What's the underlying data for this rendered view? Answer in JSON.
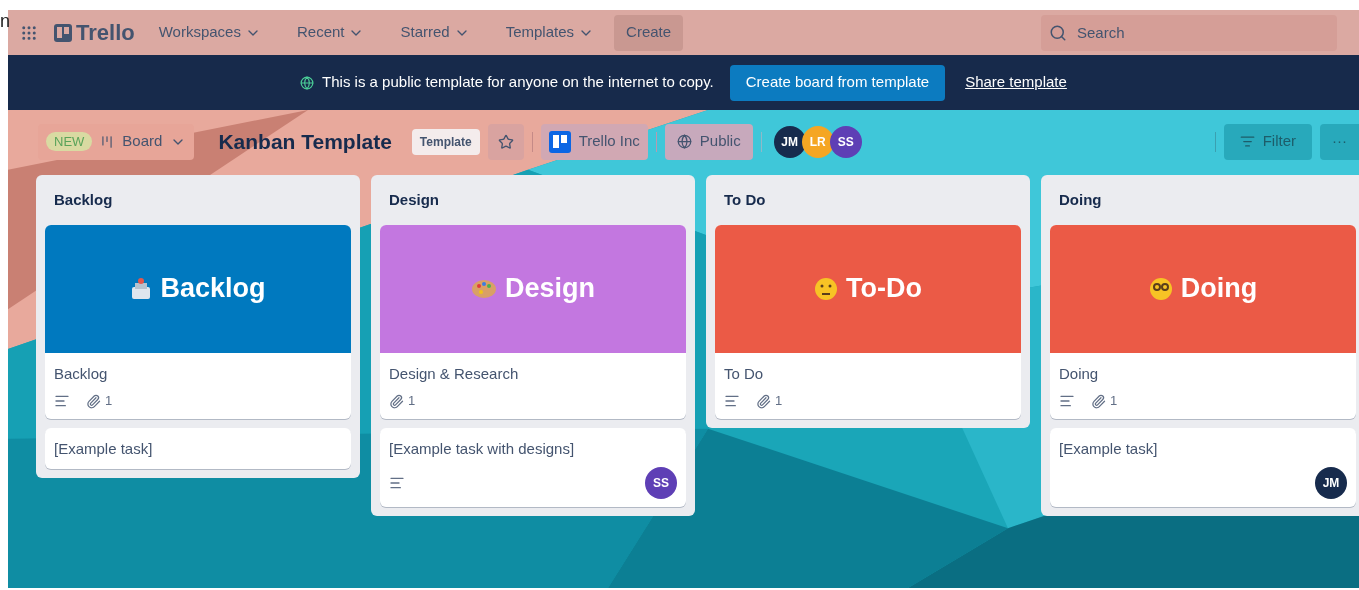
{
  "edge_fragment": "n",
  "nav": {
    "logo": "Trello",
    "menus": [
      {
        "label": "Workspaces"
      },
      {
        "label": "Recent"
      },
      {
        "label": "Starred"
      },
      {
        "label": "Templates"
      }
    ],
    "create": "Create",
    "search": {
      "placeholder": "Search"
    }
  },
  "banner": {
    "text": "This is a public template for anyone on the internet to copy.",
    "button": "Create board from template",
    "link": "Share template"
  },
  "board_header": {
    "new_badge": "NEW",
    "view": "Board",
    "title": "Kanban Template",
    "template_badge": "Template",
    "starred": false,
    "workspace": "Trello Inc",
    "visibility": "Public",
    "members": [
      {
        "initials": "JM",
        "color": "#172b4d"
      },
      {
        "initials": "LR",
        "color": "#f5a623"
      },
      {
        "initials": "SS",
        "color": "#5e3fb5"
      }
    ],
    "filter": "Filter",
    "more": "···"
  },
  "lists": [
    {
      "title": "Backlog",
      "cards": [
        {
          "cover": {
            "title": "Backlog",
            "color": "#0079bf"
          },
          "title": "Backlog",
          "description": true,
          "attachments": "1"
        },
        {
          "title": "[Example task]",
          "description": false
        }
      ]
    },
    {
      "title": "Design",
      "cards": [
        {
          "cover": {
            "title": "Design",
            "color": "#c377e0"
          },
          "title": "Design & Research",
          "description": false,
          "attachments": "1"
        },
        {
          "title": "[Example task with designs]",
          "description": true,
          "member": {
            "initials": "SS",
            "color": "#5e3fb5"
          }
        }
      ]
    },
    {
      "title": "To Do",
      "cards": [
        {
          "cover": {
            "title": "To-Do",
            "color": "#eb5a46"
          },
          "title": "To Do",
          "description": true,
          "attachments": "1"
        }
      ]
    },
    {
      "title": "Doing",
      "cards": [
        {
          "cover": {
            "title": "Doing",
            "color": "#eb5a46"
          },
          "title": "Doing",
          "description": true,
          "attachments": "1"
        },
        {
          "title": "[Example task]",
          "description": false,
          "member": {
            "initials": "JM",
            "color": "#172b4d"
          }
        }
      ]
    }
  ]
}
